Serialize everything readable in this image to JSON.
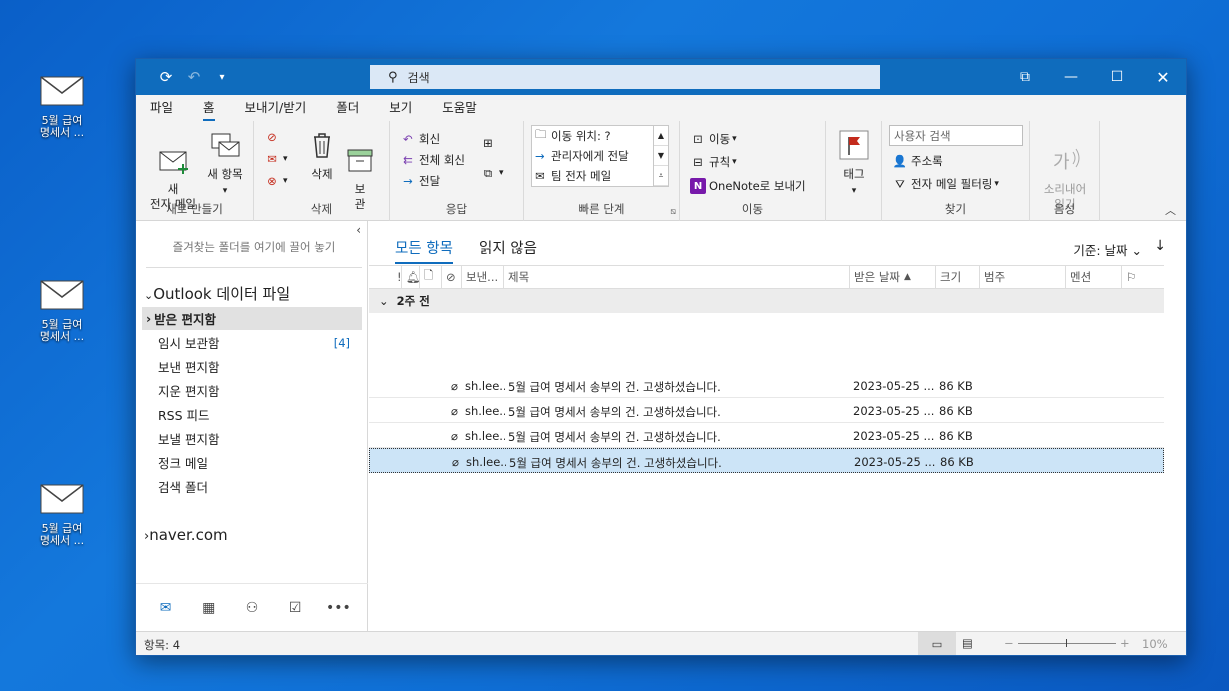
{
  "desktop": {
    "icons": [
      {
        "label": "5월 급여\n명세서 ..."
      },
      {
        "label": "5월 급여\n명세서 ..."
      },
      {
        "label": "5월 급여\n명세서 ..."
      }
    ]
  },
  "titlebar": {
    "search_placeholder": "검색"
  },
  "menu": [
    "파일",
    "홈",
    "보내기/받기",
    "폴더",
    "보기",
    "도움말"
  ],
  "ribbon": {
    "new_group": {
      "label": "새로 만들기",
      "new_mail": "새\n전자 메일",
      "new_items": "새 항목"
    },
    "delete_group": {
      "label": "삭제",
      "delete": "삭제",
      "archive": "보\n관"
    },
    "respond_group": {
      "label": "응답",
      "reply": "회신",
      "reply_all": "전체 회신",
      "forward": "전달"
    },
    "quick_steps": {
      "label": "빠른 단계",
      "items": [
        "이동 위치: ?",
        "관리자에게 전달",
        "팀 전자 메일"
      ]
    },
    "move_group": {
      "label": "이동",
      "move": "이동",
      "rules": "규칙",
      "onenote": "OneNote로 보내기"
    },
    "tags_group": {
      "label": "",
      "tag": "태그"
    },
    "find_group": {
      "label": "찾기",
      "search_people": "사용자 검색",
      "address_book": "주소록",
      "filter_email": "전자 메일 필터링"
    },
    "voice_group": {
      "label": "음성",
      "read_aloud": "소리내어\n읽기"
    }
  },
  "folders": {
    "favorites_hint": "즐겨찾는 폴더를 여기에 끌어 놓기",
    "root": "Outlook 데이터 파일",
    "items": [
      {
        "name": "받은 편지함",
        "count": ""
      },
      {
        "name": "임시 보관함",
        "count": "[4]"
      },
      {
        "name": "보낸 편지함",
        "count": ""
      },
      {
        "name": "지운 편지함",
        "count": ""
      },
      {
        "name": "RSS 피드",
        "count": ""
      },
      {
        "name": "보낼 편지함",
        "count": ""
      },
      {
        "name": "정크 메일",
        "count": ""
      },
      {
        "name": "검색 폴더",
        "count": ""
      }
    ],
    "account": "naver.com"
  },
  "list": {
    "tabs": [
      "모든 항목",
      "읽지 않음"
    ],
    "sort_by": "기준: 날짜",
    "columns": {
      "from": "보낸...",
      "subject": "제목",
      "received": "받은 날짜",
      "size": "크기",
      "category": "범주",
      "mention": "멘션"
    },
    "group_header": "2주 전",
    "rows": [
      {
        "from": "sh.lee...",
        "subject": "5월 급여 명세서 송부의 건. 고생하셨습니다.",
        "received": "2023-05-25 ...",
        "size": "86 KB"
      },
      {
        "from": "sh.lee...",
        "subject": "5월 급여 명세서 송부의 건. 고생하셨습니다.",
        "received": "2023-05-25 ...",
        "size": "86 KB"
      },
      {
        "from": "sh.lee...",
        "subject": "5월 급여 명세서 송부의 건. 고생하셨습니다.",
        "received": "2023-05-25 ...",
        "size": "86 KB"
      },
      {
        "from": "sh.lee...",
        "subject": "5월 급여 명세서 송부의 건. 고생하셨습니다.",
        "received": "2023-05-25 ...",
        "size": "86 KB"
      }
    ]
  },
  "status": {
    "items": "항목: 4",
    "zoom": "10%"
  }
}
